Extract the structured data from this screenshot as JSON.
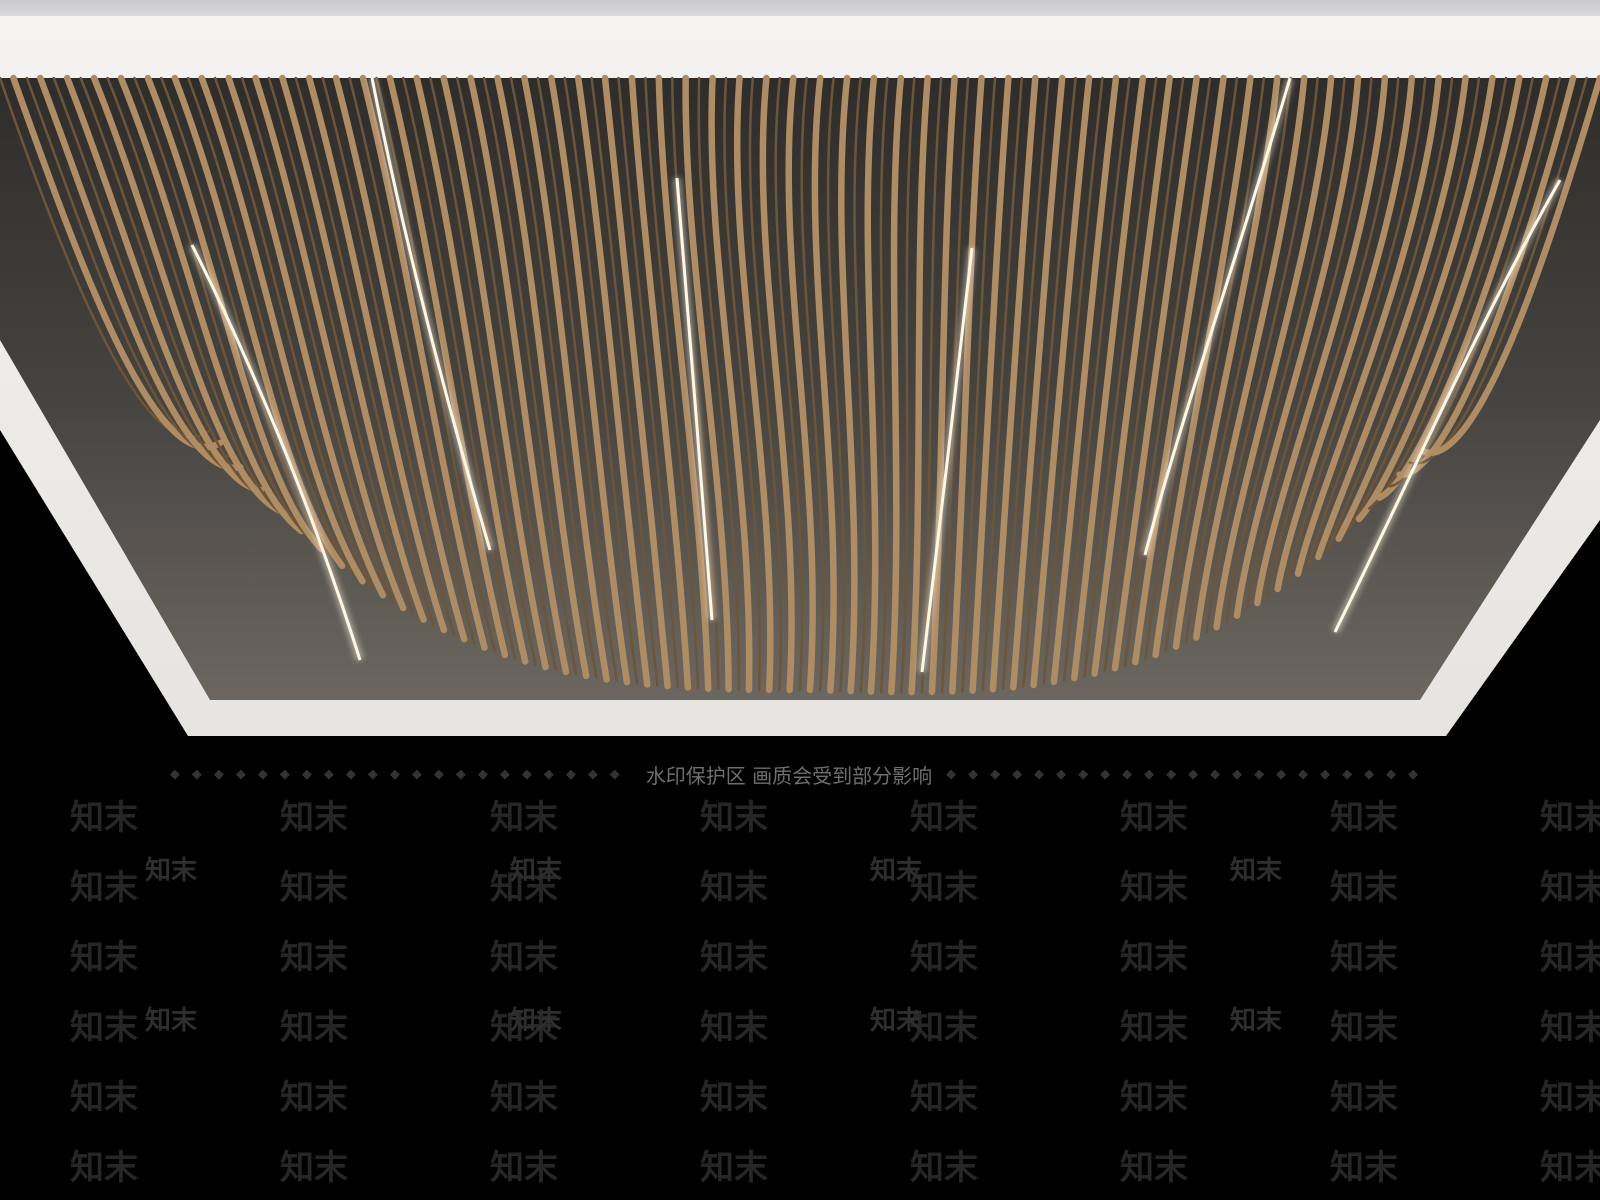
{
  "scene": {
    "subject": "ceiling",
    "colors": {
      "frame": "#f2f1ef",
      "frame_shadow": "#d6d4d0",
      "void": "#3a3936",
      "slat": "#b08c62",
      "slat_dark": "#6e5538",
      "light_strip": "#fff6e4",
      "background": "#000000"
    }
  },
  "watermark": {
    "banner_text": "水印保护区   画质会受到部分影响",
    "brand": "知末"
  }
}
